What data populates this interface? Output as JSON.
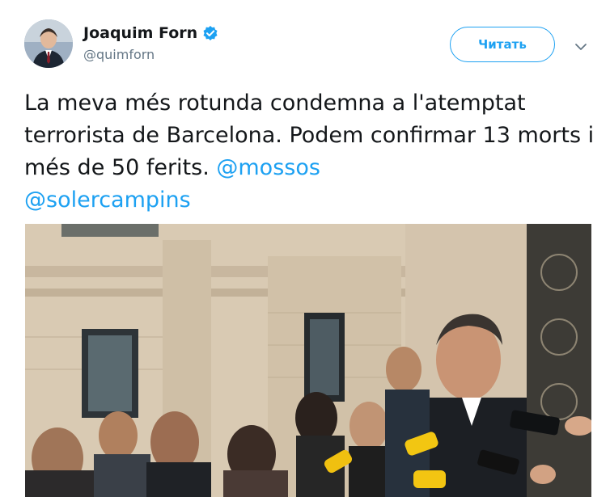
{
  "tweet": {
    "author_name": "Joaquim Forn",
    "author_handle": "@quimforn",
    "follow_label": "Читать",
    "text_plain": "La meva més rotunda condemna a l'atemptat terrorista de Barcelona. Podem confirmar 13 morts i més de 50 ferits. ",
    "mentions": [
      "@mossos",
      "@solercampins"
    ],
    "icons": {
      "verified": "verified-badge-icon",
      "menu": "chevron-down-icon"
    },
    "colors": {
      "accent": "#1da1f2",
      "text": "#14171a",
      "secondary": "#657786"
    }
  }
}
